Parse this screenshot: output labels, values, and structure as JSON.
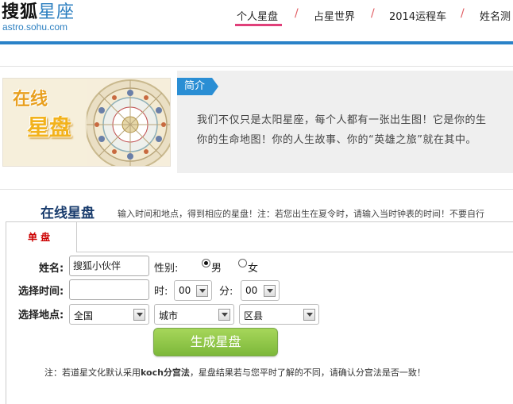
{
  "header": {
    "logo_main": "搜狐",
    "logo_sub": "星座",
    "logo_url": "astro.sohu.com",
    "nav": [
      "个人星盘",
      "占星世界",
      "2014运程车",
      "姓名测"
    ],
    "nav_separator": "/",
    "active_nav": "个人星盘"
  },
  "intro": {
    "image_text_1": "在线",
    "image_text_2": "星盘",
    "tab_label": "简介",
    "line1": "我们不仅只是太阳星座，每个人都有一张出生图！它是你的生",
    "line2": "你的生命地图！你的人生故事、你的“英雄之旅”就在其中。"
  },
  "section": {
    "title": "在线星盘",
    "desc": "输入时间和地点，得到相应的星盘！注：若您出生在夏令时，请输入当时钟表的时间！不要自行"
  },
  "form": {
    "tab_label": "单 盘",
    "name_label": "姓名:",
    "name_value": "搜狐小伙伴",
    "gender_label": "性别:",
    "male_label": "男",
    "female_label": "女",
    "gender_selected": "男",
    "time_label": "选择时间:",
    "time_value": "",
    "hour_label": "时:",
    "hour_value": "00",
    "minute_label": "分:",
    "minute_value": "00",
    "place_label": "选择地点:",
    "country_value": "全国",
    "city_value": "城市",
    "district_value": "区县",
    "submit_label": "生成星盘",
    "note_prefix": "注：若道星文化默认采用",
    "note_bold": "koch分宫法",
    "note_suffix": "，星盘结果若与您平时了解的不同，请确认分宫法是否一致！"
  },
  "colors": {
    "accent_blue": "#2a82c8",
    "nav_separator": "#e05a60",
    "nav_underline": "#e0407a",
    "button_green": "#8cc548",
    "section_title": "#1a3d6e"
  }
}
